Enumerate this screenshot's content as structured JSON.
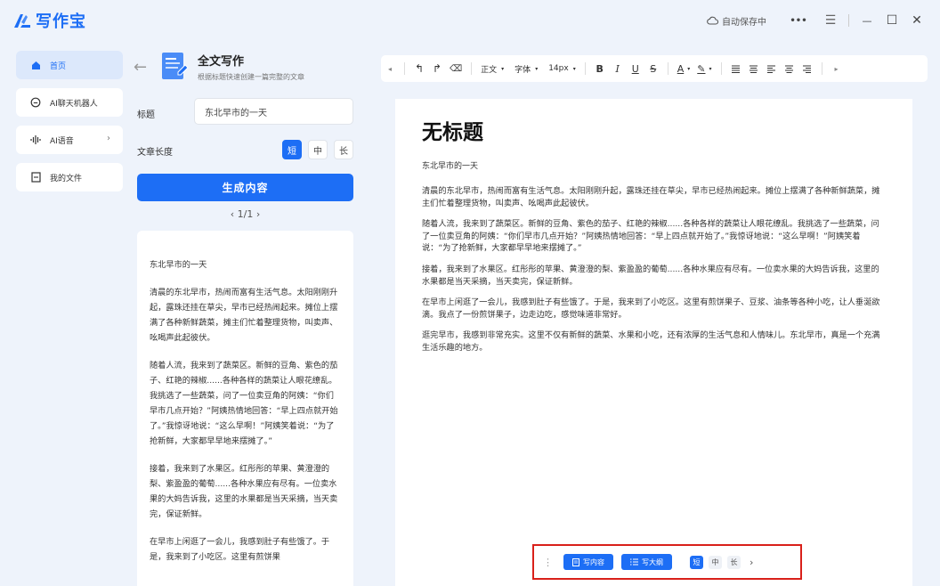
{
  "app": {
    "name": "写作宝"
  },
  "titlebar": {
    "autosave": "自动保存中",
    "more": "•••",
    "menu": "☰",
    "minimize": "—",
    "maximize": "☐",
    "close": "✕"
  },
  "sidebar": {
    "items": [
      {
        "label": "首页",
        "active": true
      },
      {
        "label": "AI聊天机器人"
      },
      {
        "label": "AI语音",
        "chevron": "›"
      },
      {
        "label": "我的文件"
      }
    ]
  },
  "panel": {
    "back": "←",
    "title": "全文写作",
    "subtitle": "根据标题快速创建一篇完整的文章",
    "title_label": "标题",
    "title_value": "东北早市的一天",
    "length_label": "文章长度",
    "length_options": [
      "短",
      "中",
      "长"
    ],
    "generate": "生成内容",
    "pager": "‹  1/1  ›",
    "preview": [
      "东北早市的一天",
      "清晨的东北早市，热闹而富有生活气息。太阳刚刚升起，露珠还挂在草尖，早市已经热闹起来。摊位上摆满了各种新鲜蔬菜，摊主们忙着整理货物，叫卖声、吆喝声此起彼伏。",
      "随着人流，我来到了蔬菜区。新鲜的豆角、紫色的茄子、红艳的辣椒......各种各样的蔬菜让人眼花缭乱。我挑选了一些蔬菜，问了一位卖豆角的阿姨：“你们早市几点开始？”阿姨热情地回答：“早上四点就开始了。”我惊讶地说：“这么早啊！”阿姨笑着说：“为了抢新鲜，大家都早早地来摆摊了。”",
      "接着，我来到了水果区。红彤彤的苹果、黄澄澄的梨、紫盈盈的葡萄......各种水果应有尽有。一位卖水果的大妈告诉我，这里的水果都是当天采摘，当天卖完，保证新鲜。",
      "在早市上闲逛了一会儿，我感到肚子有些饿了。于是，我来到了小吃区。这里有煎饼果"
    ]
  },
  "toolbar": {
    "left_arrow": "◂",
    "undo": "↰",
    "redo": "↱",
    "clear": "⌫",
    "paragraph": "正文",
    "font": "字体",
    "size": "14px",
    "bold": "B",
    "italic": "I",
    "underline": "U",
    "strike": "S",
    "font_color": "A",
    "highlight": "✎",
    "right_arrow": "▸"
  },
  "editor": {
    "title": "无标题",
    "subtitle": "东北早市的一天",
    "paragraphs": [
      "清晨的东北早市，热闹而富有生活气息。太阳刚刚升起，露珠还挂在草尖，早市已经热闹起来。摊位上摆满了各种新鲜蔬菜，摊主们忙着整理货物，叫卖声、吆喝声此起彼伏。",
      "随着人流，我来到了蔬菜区。新鲜的豆角、紫色的茄子、红艳的辣椒......各种各样的蔬菜让人眼花缭乱。我挑选了一些蔬菜，问了一位卖豆角的阿姨：“你们早市几点开始？”阿姨热情地回答：“早上四点就开始了。”我惊讶地说：“这么早啊！”阿姨笑着说：“为了抢新鲜，大家都早早地来摆摊了。”",
      "接着，我来到了水果区。红彤彤的苹果、黄澄澄的梨、紫盈盈的葡萄......各种水果应有尽有。一位卖水果的大妈告诉我，这里的水果都是当天采摘，当天卖完，保证新鲜。",
      "在早市上闲逛了一会儿，我感到肚子有些饿了。于是，我来到了小吃区。这里有煎饼果子、豆浆、油条等各种小吃，让人垂涎欲滴。我点了一份煎饼果子，边走边吃，感觉味道非常好。",
      "逛完早市，我感到非常充实。这里不仅有新鲜的蔬菜、水果和小吃，还有浓厚的生活气息和人情味儿。东北早市，真是一个充满生活乐趣的地方。"
    ]
  },
  "floatbar": {
    "drag": "⋮",
    "write_content": "写内容",
    "write_outline": "写大纲",
    "length_options": [
      "短",
      "中",
      "长"
    ],
    "next": "›"
  },
  "colors": {
    "accent": "#1d6ef5",
    "highlight_border": "#d9201a",
    "background": "#eef3fb"
  }
}
